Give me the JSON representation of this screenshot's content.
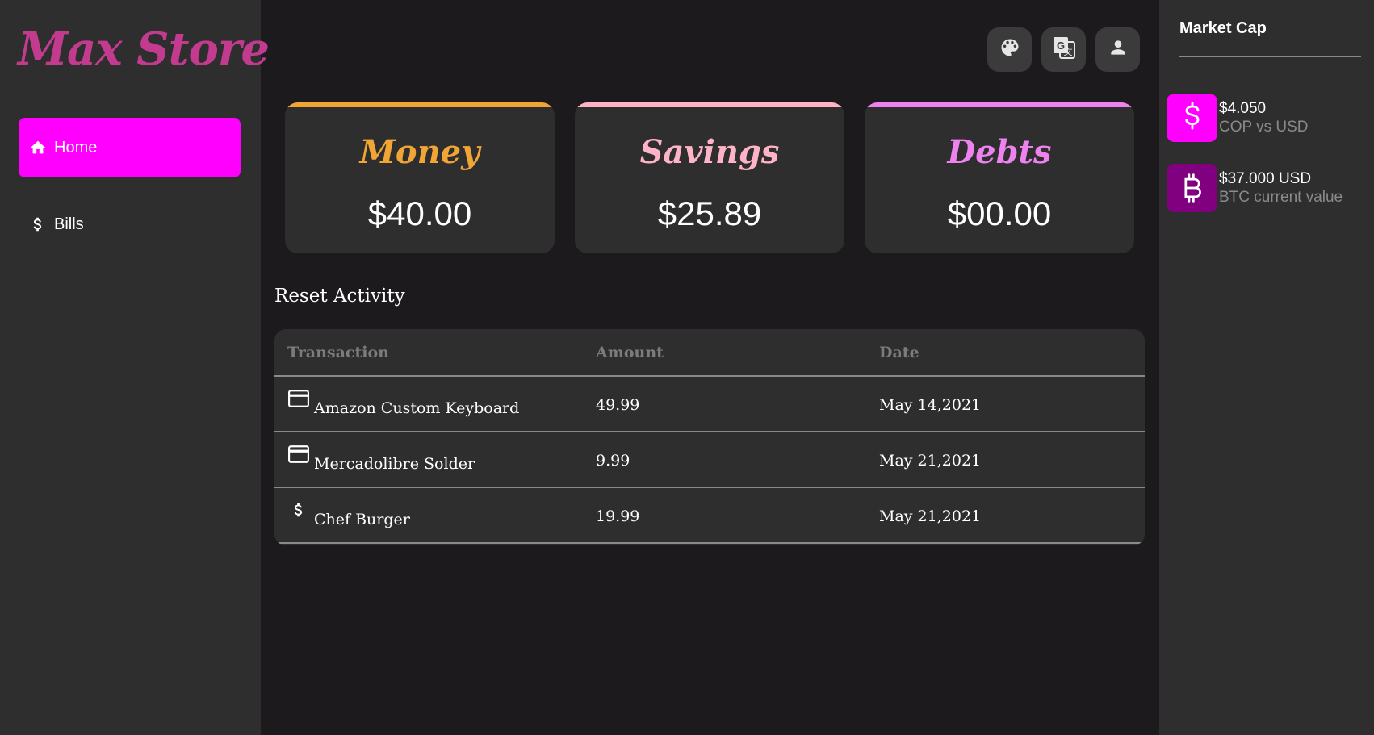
{
  "app": {
    "logo": "Max Store"
  },
  "sidebar": {
    "items": [
      {
        "label": "Home",
        "icon": "home-icon",
        "active": true
      },
      {
        "label": "Bills",
        "icon": "dollar-icon",
        "active": false
      }
    ]
  },
  "topbar": {
    "buttons": [
      {
        "icon": "palette-icon"
      },
      {
        "icon": "translate-icon"
      },
      {
        "icon": "user-icon"
      }
    ]
  },
  "cards": [
    {
      "title": "Money",
      "value": "$40.00",
      "color": "#f0a535"
    },
    {
      "title": "Savings",
      "value": "$25.89",
      "color": "#ffb3c6"
    },
    {
      "title": "Debts",
      "value": "$00.00",
      "color": "#ee82ee"
    }
  ],
  "activity": {
    "title": "Reset Activity",
    "columns": [
      "Transaction",
      "Amount",
      "Date"
    ],
    "rows": [
      {
        "icon": "credit-card-icon",
        "name": "Amazon Custom Keyboard",
        "amount": "49.99",
        "date": "May 14,2021"
      },
      {
        "icon": "credit-card-icon",
        "name": "Mercadolibre Solder",
        "amount": "9.99",
        "date": "May 21,2021"
      },
      {
        "icon": "dollar-icon",
        "name": "Chef Burger",
        "amount": "19.99",
        "date": "May 21,2021"
      }
    ]
  },
  "market": {
    "title": "Market Cap",
    "items": [
      {
        "icon": "dollar-icon",
        "value": "$4.050",
        "desc": "COP vs USD",
        "color": "#ff00ff"
      },
      {
        "icon": "bitcoin-icon",
        "value": "$37.000 USD",
        "desc": "BTC current value",
        "color": "#800080"
      }
    ]
  },
  "colors": {
    "accent": "#ff00ff",
    "logo": "#c23b8f",
    "background": "#1c1a1c",
    "panel": "#2e2e2e"
  }
}
